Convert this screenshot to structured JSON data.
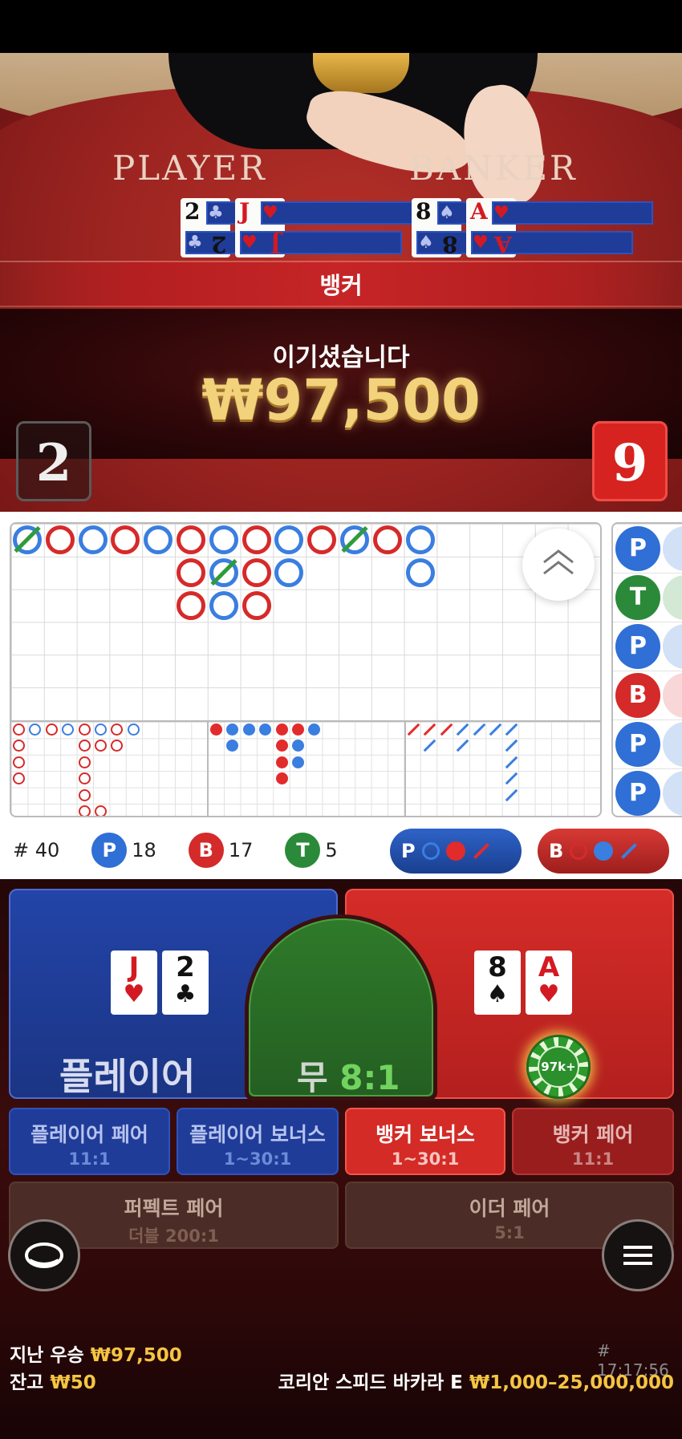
{
  "video": {
    "player_label": "PLAYER",
    "banker_label": "BANKER",
    "player_cards": [
      {
        "rank": "2",
        "suit": "♣"
      },
      {
        "rank": "J",
        "suit": "♥"
      }
    ],
    "banker_cards": [
      {
        "rank": "8",
        "suit": "♠"
      },
      {
        "rank": "A",
        "suit": "♥"
      }
    ],
    "result": "뱅커",
    "win_message": "이기셨습니다",
    "win_amount": "₩97,500",
    "player_score": "2",
    "banker_score": "9"
  },
  "roadmap": {
    "big_road": [
      [
        "P"
      ],
      [
        "B"
      ],
      [
        "P"
      ],
      [
        "B"
      ],
      [
        "P"
      ],
      [
        "B",
        "B",
        "B"
      ],
      [
        "P",
        "P",
        "P"
      ],
      [
        "B",
        "B",
        "B"
      ],
      [
        "P",
        "P"
      ],
      [
        "B"
      ],
      [
        "P"
      ],
      [
        "B"
      ],
      [
        "P",
        "P"
      ]
    ],
    "bead_column": [
      "P",
      "T",
      "P",
      "B",
      "P",
      "P"
    ]
  },
  "stats": {
    "total": "# 40",
    "player_count": "18",
    "banker_count": "17",
    "tie_count": "5",
    "player_letter": "P",
    "banker_letter": "B",
    "tie_letter": "T"
  },
  "ask_buttons": {
    "player": "P",
    "banker": "B"
  },
  "betting": {
    "player_label": "플레이어",
    "tie_label": "무",
    "tie_odds": "8:1",
    "player_cards": [
      {
        "rank": "J",
        "suit": "♥"
      },
      {
        "rank": "2",
        "suit": "♣"
      }
    ],
    "banker_cards": [
      {
        "rank": "8",
        "suit": "♠"
      },
      {
        "rank": "A",
        "suit": "♥"
      }
    ],
    "chip_value": "97k+",
    "side_bets": [
      {
        "label": "플레이어 페어",
        "odds": "11:1"
      },
      {
        "label": "플레이어 보너스",
        "odds": "1~30:1"
      },
      {
        "label": "뱅커 보너스",
        "odds": "1~30:1"
      },
      {
        "label": "뱅커 페어",
        "odds": "11:1"
      },
      {
        "label": "퍼펙트 페어",
        "odds": "더블 200:1"
      },
      {
        "label": "이더 페어",
        "odds": "5:1"
      }
    ]
  },
  "footer": {
    "last_win_label": "지난 우승",
    "last_win_value": "₩97,500",
    "balance_label": "잔고",
    "balance_value": "₩50",
    "round_time": "# 17:17:56",
    "table_name": "코리안 스피드 바카라 E",
    "table_limits": "₩1,000–25,000,000"
  },
  "colors": {
    "player": "#2f6fd6",
    "banker": "#d42a2a",
    "tie": "#2a8a3a",
    "gold": "#f4c542"
  }
}
